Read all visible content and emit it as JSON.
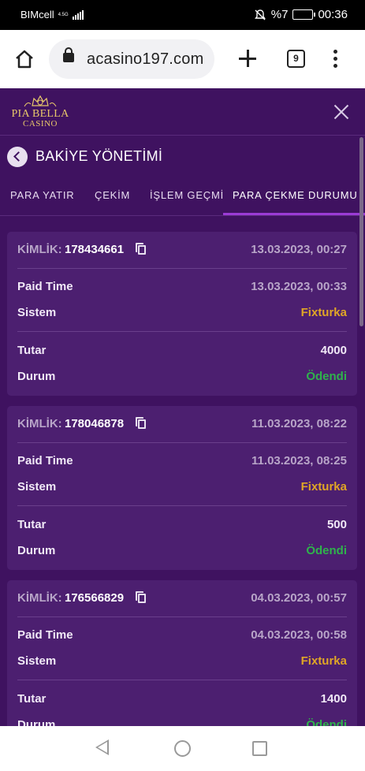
{
  "status_bar": {
    "carrier": "BIMcell",
    "network": "4.5G",
    "battery_percent": "%7",
    "time": "00:36"
  },
  "browser": {
    "url": "acasino197.com",
    "tab_count": "9"
  },
  "app": {
    "logo": {
      "line1": "PIA BELLA",
      "line2": "CASINO"
    },
    "page_title": "BAKİYE YÖNETİMİ",
    "tabs": [
      {
        "label": "PARA YATIR",
        "active": false
      },
      {
        "label": "ÇEKİM",
        "active": false
      },
      {
        "label": "İŞLEM GEÇMİ",
        "active": false
      },
      {
        "label": "PARA ÇEKME DURUMU",
        "active": true
      }
    ],
    "labels": {
      "id": "KİMLİK:",
      "paid_time": "Paid Time",
      "system": "Sistem",
      "amount": "Tutar",
      "status": "Durum"
    },
    "withdrawals": [
      {
        "id": "178434661",
        "created": "13.03.2023, 00:27",
        "paid_time": "13.03.2023, 00:33",
        "system": "Fixturka",
        "amount": "4000",
        "status": "Ödendi"
      },
      {
        "id": "178046878",
        "created": "11.03.2023, 08:22",
        "paid_time": "11.03.2023, 08:25",
        "system": "Fixturka",
        "amount": "500",
        "status": "Ödendi"
      },
      {
        "id": "176566829",
        "created": "04.03.2023, 00:57",
        "paid_time": "04.03.2023, 00:58",
        "system": "Fixturka",
        "amount": "1400",
        "status": "Ödendi"
      }
    ]
  },
  "colors": {
    "app_bg": "#3f1260",
    "card_bg": "#4c1f70",
    "accent": "#9c3bd6",
    "system": "#e0a626",
    "paid": "#2fb34c"
  }
}
